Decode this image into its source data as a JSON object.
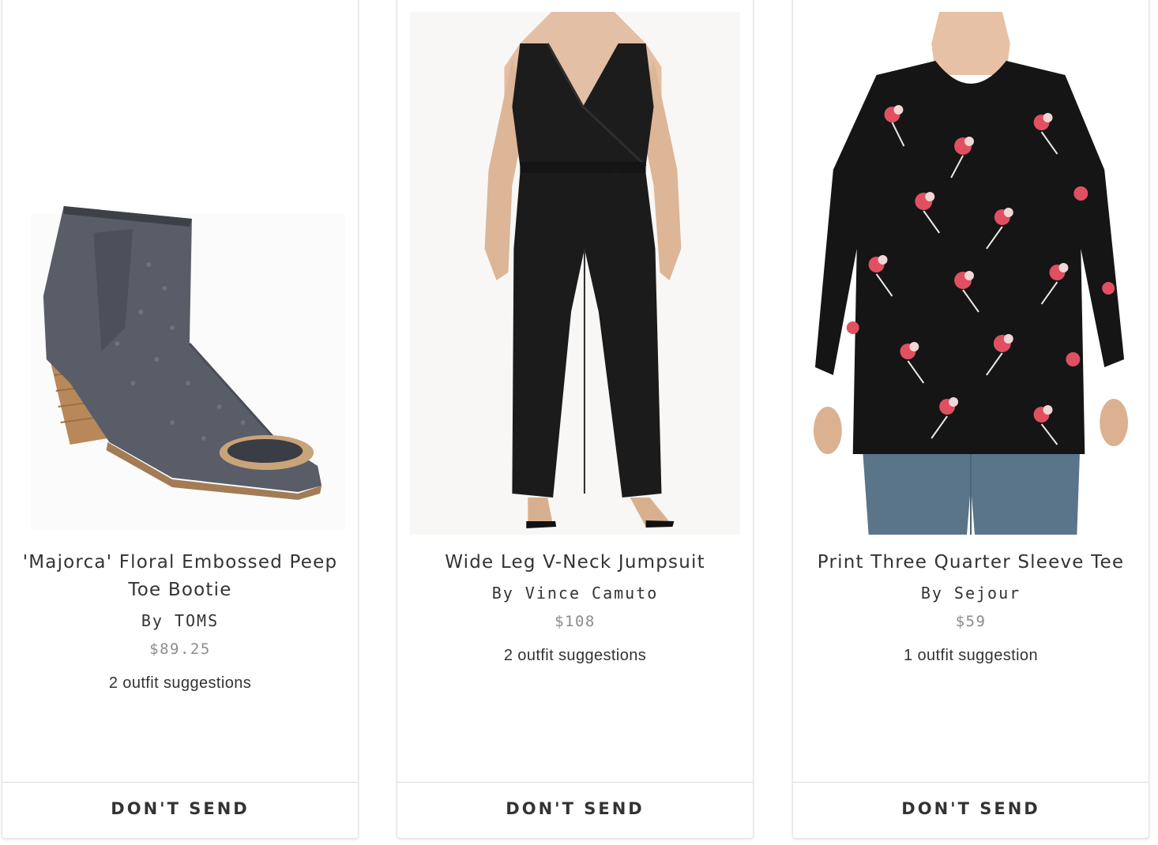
{
  "products": [
    {
      "title": "'Majorca' Floral Embossed Peep Toe Bootie",
      "brand": "By TOMS",
      "price": "$89.25",
      "suggestions": "2 outfit suggestions",
      "action_label": "DON'T SEND",
      "image_icon": "ankle-bootie"
    },
    {
      "title": "Wide Leg V-Neck Jumpsuit",
      "brand": "By Vince Camuto",
      "price": "$108",
      "suggestions": "2 outfit suggestions",
      "action_label": "DON'T SEND",
      "image_icon": "black-jumpsuit"
    },
    {
      "title": "Print Three Quarter Sleeve Tee",
      "brand": "By Sejour",
      "price": "$59",
      "suggestions": "1 outfit suggestion",
      "action_label": "DON'T SEND",
      "image_icon": "floral-print-tee"
    }
  ],
  "colors": {
    "text": "#333333",
    "price": "#8c8c8c",
    "card_border": "#e4e4e4",
    "divider": "#dcdcdc"
  }
}
